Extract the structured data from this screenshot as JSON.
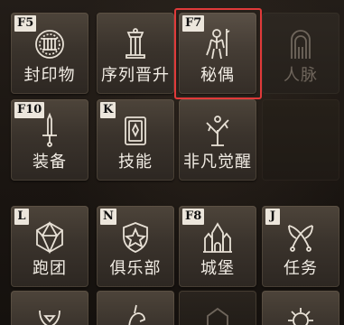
{
  "menu": {
    "row1": [
      {
        "key": "F5",
        "label": "封印物",
        "icon": "seal-icon"
      },
      {
        "key": "",
        "label": "序列晋升",
        "icon": "pillar-icon"
      },
      {
        "key": "F7",
        "label": "秘偶",
        "icon": "marionette-icon",
        "selected": true
      },
      {
        "key": "",
        "label": "人脉",
        "icon": "doorway-icon",
        "disabled": true
      }
    ],
    "row2": [
      {
        "key": "F10",
        "label": "装备",
        "icon": "sword-icon"
      },
      {
        "key": "K",
        "label": "技能",
        "icon": "book-icon"
      },
      {
        "key": "",
        "label": "非凡觉醒",
        "icon": "tree-icon"
      }
    ],
    "row3": [
      {
        "key": "L",
        "label": "跑团",
        "icon": "d20-dice-icon"
      },
      {
        "key": "N",
        "label": "俱乐部",
        "icon": "crest-icon"
      },
      {
        "key": "F8",
        "label": "城堡",
        "icon": "castle-icon"
      },
      {
        "key": "J",
        "label": "任务",
        "icon": "crossed-quills-icon"
      }
    ],
    "row4_icons": [
      "laurel-icon",
      "unicorn-icon",
      "frame-icon",
      "gear-icon"
    ]
  },
  "colors": {
    "highlight_border": "#e03a3a",
    "label_text": "#f1ece4",
    "icon_stroke": "#e8e1d6"
  }
}
